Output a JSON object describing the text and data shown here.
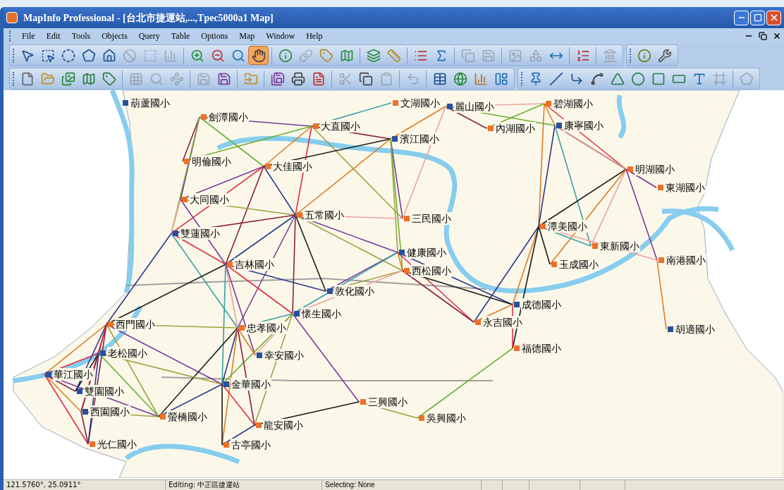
{
  "window": {
    "title": "MapInfo Professional - [台北市捷運站,...,Tpec5000a1 Map]"
  },
  "menu": [
    "File",
    "Edit",
    "Tools",
    "Objects",
    "Query",
    "Table",
    "Options",
    "Map",
    "Window",
    "Help"
  ],
  "toolbars": [
    {
      "tools": [
        {
          "selected": false,
          "disabled": false
        },
        {
          "selected": false,
          "disabled": false
        },
        {
          "selected": false,
          "disabled": false
        },
        {
          "selected": false,
          "disabled": false
        },
        {
          "selected": false,
          "disabled": false
        },
        {
          "selected": false,
          "disabled": true
        },
        {
          "selected": false,
          "disabled": true
        },
        {
          "selected": false,
          "disabled": true
        },
        {
          "selected": false,
          "disabled": false
        },
        {
          "selected": false,
          "disabled": false
        },
        {
          "selected": false,
          "disabled": false
        },
        {
          "selected": true,
          "disabled": false
        },
        {
          "selected": false,
          "disabled": false
        },
        {
          "selected": false,
          "disabled": true
        },
        {
          "selected": false,
          "disabled": false
        },
        {
          "selected": false,
          "disabled": false
        },
        {
          "selected": false,
          "disabled": false
        },
        {
          "selected": false,
          "disabled": false
        },
        {
          "selected": false,
          "disabled": false
        },
        {
          "selected": false,
          "disabled": false
        },
        {
          "selected": false,
          "disabled": true
        },
        {
          "selected": false,
          "disabled": true
        },
        {
          "selected": false,
          "disabled": true
        },
        {
          "selected": false,
          "disabled": true
        },
        {
          "selected": false,
          "disabled": false
        },
        {
          "selected": false,
          "disabled": false
        },
        {
          "selected": false,
          "disabled": true
        }
      ]
    },
    {
      "tools": [
        {
          "selected": false,
          "disabled": false
        },
        {
          "selected": false,
          "disabled": false
        }
      ]
    },
    {
      "tools": [
        {
          "selected": false,
          "disabled": false
        },
        {
          "selected": false,
          "disabled": false
        },
        {
          "selected": false,
          "disabled": false
        },
        {
          "selected": false,
          "disabled": false
        },
        {
          "selected": false,
          "disabled": false
        },
        {
          "selected": false,
          "disabled": true
        },
        {
          "selected": false,
          "disabled": true
        },
        {
          "selected": false,
          "disabled": true
        },
        {
          "selected": false,
          "disabled": true
        },
        {
          "selected": false,
          "disabled": false
        },
        {
          "selected": false,
          "disabled": false
        },
        {
          "selected": false,
          "disabled": false
        },
        {
          "selected": false,
          "disabled": false
        },
        {
          "selected": false,
          "disabled": false
        },
        {
          "selected": false,
          "disabled": true
        },
        {
          "selected": false,
          "disabled": false
        },
        {
          "selected": false,
          "disabled": true
        },
        {
          "selected": false,
          "disabled": true
        },
        {
          "selected": false,
          "disabled": false
        },
        {
          "selected": false,
          "disabled": false
        },
        {
          "selected": false,
          "disabled": false
        },
        {
          "selected": false,
          "disabled": false
        }
      ]
    },
    {
      "tools": [
        {
          "selected": false,
          "disabled": false
        },
        {
          "selected": false,
          "disabled": false
        },
        {
          "selected": false,
          "disabled": false
        },
        {
          "selected": false,
          "disabled": false
        },
        {
          "selected": false,
          "disabled": false
        },
        {
          "selected": false,
          "disabled": false
        },
        {
          "selected": false,
          "disabled": false
        },
        {
          "selected": false,
          "disabled": false
        },
        {
          "selected": false,
          "disabled": false
        },
        {
          "selected": false,
          "disabled": true
        },
        {
          "selected": false,
          "disabled": true
        }
      ]
    }
  ],
  "map": {
    "schools": [
      {
        "name": "葫蘆國小",
        "color": "#2850a0"
      },
      {
        "name": "劍潭國小",
        "color": "#f07028"
      },
      {
        "name": "大直國小",
        "color": "#f07028"
      },
      {
        "name": "文湖國小",
        "color": "#f07028"
      },
      {
        "name": "麗山國小",
        "color": "#2850a0"
      },
      {
        "name": "碧湖國小",
        "color": "#f07028"
      },
      {
        "name": "內湖國小",
        "color": "#f07028"
      },
      {
        "name": "康寧國小",
        "color": "#2850a0"
      },
      {
        "name": "濱江國小",
        "color": "#2850a0"
      },
      {
        "name": "明倫國小",
        "color": "#f07028"
      },
      {
        "name": "大佳國小",
        "color": "#f07028"
      },
      {
        "name": "明湖國小",
        "color": "#f07028"
      },
      {
        "name": "東湖國小",
        "color": "#f07028"
      },
      {
        "name": "大同國小",
        "color": "#f07028"
      },
      {
        "name": "五常國小",
        "color": "#f07028"
      },
      {
        "name": "三民國小",
        "color": "#f07028"
      },
      {
        "name": "雙蓮國小",
        "color": "#2850a0"
      },
      {
        "name": "潭美國小",
        "color": "#f07028"
      },
      {
        "name": "東新國小",
        "color": "#f07028"
      },
      {
        "name": "健康國小",
        "color": "#2850a0"
      },
      {
        "name": "吉林國小",
        "color": "#f07028"
      },
      {
        "name": "玉成國小",
        "color": "#f07028"
      },
      {
        "name": "南港國小",
        "color": "#f07028"
      },
      {
        "name": "西松國小",
        "color": "#f07028"
      },
      {
        "name": "敦化國小",
        "color": "#2850a0"
      },
      {
        "name": "成德國小",
        "color": "#2850a0"
      },
      {
        "name": "懷生國小",
        "color": "#2850a0"
      },
      {
        "name": "永吉國小",
        "color": "#f07028"
      },
      {
        "name": "西門國小",
        "color": "#f07028"
      },
      {
        "name": "忠孝國小",
        "color": "#f07028"
      },
      {
        "name": "胡適國小",
        "color": "#2850a0"
      },
      {
        "name": "福德國小",
        "color": "#f07028"
      },
      {
        "name": "老松國小",
        "color": "#2850a0"
      },
      {
        "name": "幸安國小",
        "color": "#2850a0"
      },
      {
        "name": "華江國小",
        "color": "#2850a0"
      },
      {
        "name": "金華國小",
        "color": "#2850a0"
      },
      {
        "name": "雙園國小",
        "color": "#2850a0"
      },
      {
        "name": "三興國小",
        "color": "#f07028"
      },
      {
        "name": "西園國小",
        "color": "#2850a0"
      },
      {
        "name": "螢橋國小",
        "color": "#f07028"
      },
      {
        "name": "吳興國小",
        "color": "#f07028"
      },
      {
        "name": "龍安國小",
        "color": "#f07028"
      },
      {
        "name": "光仁國小",
        "color": "#f07028"
      },
      {
        "name": "古亭國小",
        "color": "#f07028"
      }
    ]
  },
  "status_bar": [
    "121.5760°, 25.0911°",
    "Editing: 中正區捷運站",
    "Selecting: None"
  ]
}
